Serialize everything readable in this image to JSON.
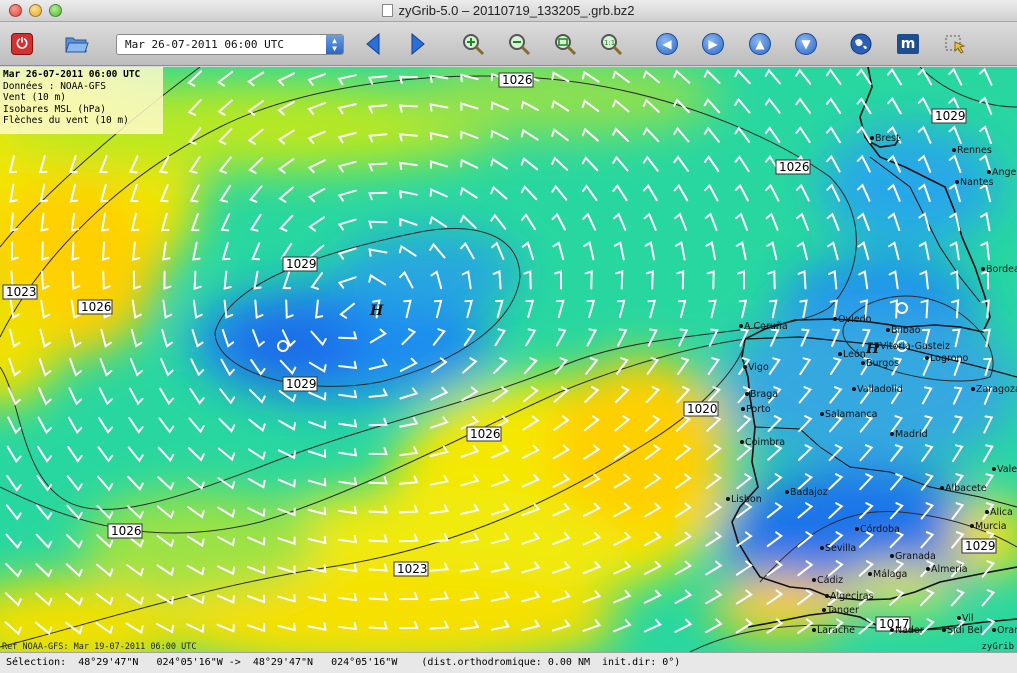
{
  "window": {
    "title": "zyGrib-5.0 – 20110719_133205_.grb.bz2"
  },
  "toolbar": {
    "quit_icon": "power-icon",
    "open_icon": "folder-open-icon",
    "date_value": "Mar 26-07-2011 06:00 UTC",
    "icons": [
      "arrow-left-icon",
      "arrow-right-icon",
      "zoom-in-icon",
      "zoom-out-icon",
      "zoom-fit-icon",
      "zoom-1to1-icon",
      "nav-left-icon",
      "nav-right-icon",
      "nav-up-icon",
      "nav-down-icon",
      "globe-icon",
      "meteotable-icon",
      "select-zone-icon"
    ]
  },
  "legend": {
    "date": "Mar 26-07-2011 06:00 UTC",
    "source": "Données : NOAA-GFS",
    "layer1": "Vent (10 m)",
    "layer2": "Isobares MSL (hPa)",
    "layer3": "Flèches du vent (10 m)"
  },
  "isobar_labels": [
    "1026",
    "1029",
    "1026",
    "1023",
    "1026",
    "1029",
    "1029",
    "1026",
    "1020",
    "1026",
    "1023",
    "1029",
    "1017"
  ],
  "pressure_centers": [
    "H",
    "H"
  ],
  "cities": [
    "Rennes",
    "Nantes",
    "Brest",
    "Ange",
    "Bordea",
    "A Coruña",
    "Oviedo",
    "Bilbao",
    "Vitoria-Gasteiz",
    "León",
    "Burgos",
    "Logrono",
    "Vigo",
    "Valladolid",
    "Zaragoza",
    "Braga",
    "Porto",
    "Salamanca",
    "Madrid",
    "Coimbra",
    "Vale",
    "Lisbon",
    "Badajoz",
    "Albacete",
    "Alica",
    "Murcia",
    "Córdoba",
    "Sevilla",
    "Granada",
    "Almería",
    "Cádiz",
    "Málaga",
    "Algeciras",
    "Tanger",
    "Larache",
    "Nador",
    "Sidi Bel",
    "Oran",
    "Vil"
  ],
  "footer": {
    "reference": "Ref NOAA-GFS: Mar 19-07-2011 06:00 UTC",
    "brand": "zyGrib"
  },
  "status": {
    "text": "Sélection:  48°29'47\"N   024°05'16\"W ->  48°29'47\"N   024°05'16\"W    (dist.orthodromique: 0.00 NM  init.dir: 0°)"
  },
  "colors": {
    "calm": "#1e64e6",
    "moderate": "#20e0a0",
    "fresh": "#f5f000",
    "strong": "#ffb000"
  }
}
